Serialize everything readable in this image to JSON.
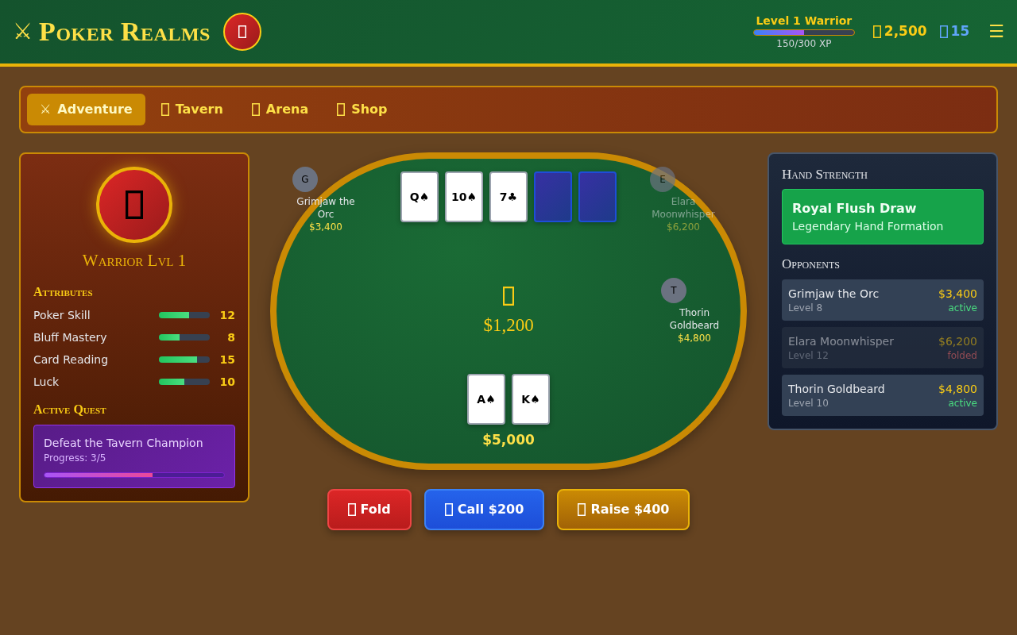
{
  "header": {
    "logo_icon": "⚔",
    "title": "Poker Realms",
    "rank": "Level 1 Warrior",
    "xp": {
      "level": 0.5,
      "reading": "150/300 XP"
    },
    "gold": "2,500",
    "gems": "15",
    "menu_icon": "☰"
  },
  "nav_tabs": [
    {
      "icon": "⚔",
      "label": "Adventure",
      "selected": true
    },
    {
      "label": "Tavern",
      "selected": false
    },
    {
      "label": "Arena",
      "selected": false
    },
    {
      "label": "Shop",
      "selected": false
    }
  ],
  "character": {
    "title": "Warrior Lvl 1",
    "attributes_heading": "Attributes",
    "attributes": [
      {
        "name": "Poker Skill",
        "level": 0.6,
        "value": "12"
      },
      {
        "name": "Bluff Mastery",
        "level": 0.4,
        "value": "8"
      },
      {
        "name": "Card Reading",
        "level": 0.75,
        "value": "15"
      },
      {
        "name": "Luck",
        "level": 0.5,
        "value": "10"
      }
    ],
    "quest_heading": "Active Quest",
    "quest": {
      "title": "Defeat the Tavern Champion",
      "progress": "Progress: 3/5",
      "level": 0.6
    }
  },
  "table": {
    "seats": [
      {
        "initial": "G",
        "name": "Grimjaw the Orc",
        "chips": "$3,400",
        "folded": false
      },
      {
        "initial": "E",
        "name": "Elara Moonwhisper",
        "chips": "$6,200",
        "folded": true
      },
      {
        "initial": "T",
        "name": "Thorin Goldbeard",
        "chips": "$4,800",
        "folded": false
      }
    ],
    "community_cards": [
      {
        "label": "Q♠",
        "face_up": true
      },
      {
        "label": "10♠",
        "face_up": true
      },
      {
        "label": "7♣",
        "face_up": true
      },
      {
        "face_up": false
      },
      {
        "face_up": false
      }
    ],
    "pot": "$1,200",
    "hand": [
      {
        "label": "A♠"
      },
      {
        "label": "K♠"
      }
    ],
    "stack": "$5,000"
  },
  "actions": [
    {
      "kind": "fold",
      "label": "Fold"
    },
    {
      "kind": "call",
      "label": "Call $200"
    },
    {
      "kind": "raise",
      "label": "Raise $400"
    }
  ],
  "hand_strength": {
    "heading": "Hand Strength",
    "name": "Royal Flush Draw",
    "description": "Legendary Hand Formation"
  },
  "opponents": {
    "heading": "Opponents",
    "items": [
      {
        "name": "Grimjaw the Orc",
        "tier": "Level 8",
        "chips": "$3,400",
        "status": "active",
        "folded": false
      },
      {
        "name": "Elara Moonwhisper",
        "tier": "Level 12",
        "chips": "$6,200",
        "status": "folded",
        "folded": true
      },
      {
        "name": "Thorin Goldbeard",
        "tier": "Level 10",
        "chips": "$4,800",
        "status": "active",
        "folded": false
      }
    ]
  }
}
